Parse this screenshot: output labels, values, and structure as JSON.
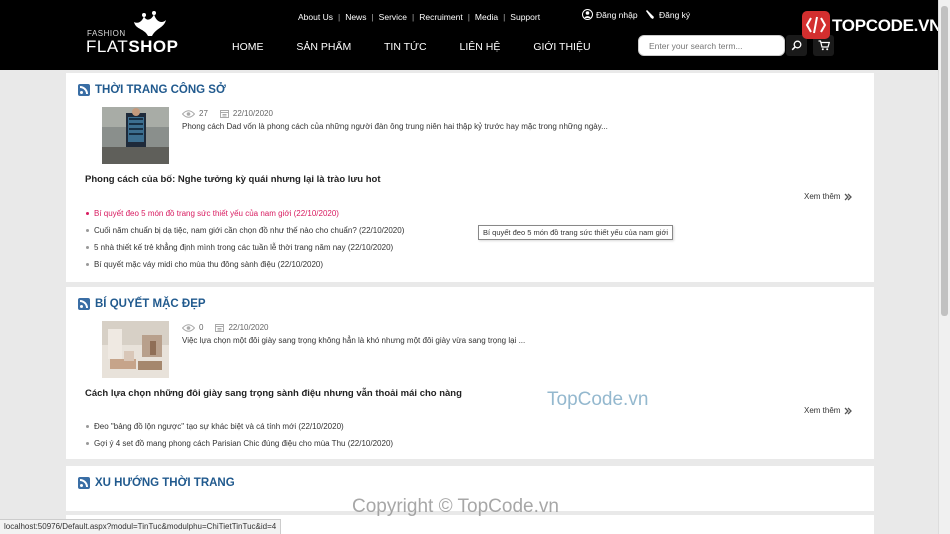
{
  "header": {
    "logo_small": "FASHION",
    "logo_brand_light": "FLAT",
    "logo_brand_bold": "SHOP",
    "top_links": [
      "About Us",
      "News",
      "Service",
      "Recruiment",
      "Media",
      "Support"
    ],
    "login_label": "Đăng nhập",
    "register_label": "Đăng ký",
    "main_nav": [
      "HOME",
      "SẢN PHẨM",
      "TIN TỨC",
      "LIÊN HỆ",
      "GIỚI THIỆU"
    ],
    "search_placeholder": "Enter your search term...",
    "badge_text": "TOPCODE.VN"
  },
  "sections": [
    {
      "title": "THỜI TRANG CÔNG SỞ",
      "featured": {
        "views": "27",
        "date": "22/10/2020",
        "excerpt": "Phong cách Dad vốn là phong cách của những người đàn ông trung niên hai thập kỷ trước hay mặc trong những ngày...",
        "headline": "Phong cách của bố: Nghe tưởng kỳ quái nhưng lại là trào lưu hot"
      },
      "more_label": "Xem thêm",
      "links": [
        "Bí quyết đeo 5 món đồ trang sức thiết yếu của nam giới (22/10/2020)",
        "Cuối năm chuẩn bị dạ tiệc, nam giới cần chọn đồ như thế nào cho chuẩn? (22/10/2020)",
        "5 nhà thiết kế trẻ khẳng định mình trong các tuần lễ thời trang năm nay (22/10/2020)",
        "Bí quyết mặc váy midi cho mùa thu đông sành điệu (22/10/2020)"
      ],
      "tooltip": "Bí quyết đeo 5 món đồ trang sức thiết yếu của nam giới"
    },
    {
      "title": "BÍ QUYẾT MẶC ĐẸP",
      "featured": {
        "views": "0",
        "date": "22/10/2020",
        "excerpt": "Việc lựa chọn một đôi giày sang trọng không hẳn là khó nhưng một đôi giày vừa sang trọng lại ...",
        "headline": "Cách lựa chọn những đôi giày sang trọng sành điệu nhưng vẫn thoải mái cho nàng"
      },
      "more_label": "Xem thêm",
      "links": [
        "Đeo \"bảng đồ lộn ngược\" tạo sự khác biệt và cá tính mới (22/10/2020)",
        "Gợi ý 4 set đồ mang phong cách Parisian Chic đúng điệu cho mùa Thu (22/10/2020)"
      ]
    },
    {
      "title": "XU HƯỚNG THỜI TRANG"
    }
  ],
  "status_url": "localhost:50976/Default.aspx?modul=TinTuc&modulphu=ChiTietTinTuc&id=4",
  "watermark_center": "TopCode.vn",
  "watermark_bottom": "Copyright © TopCode.vn",
  "colors": {
    "header_bg": "#000000",
    "section_title": "#215a8e",
    "active_link": "#d81b60"
  }
}
